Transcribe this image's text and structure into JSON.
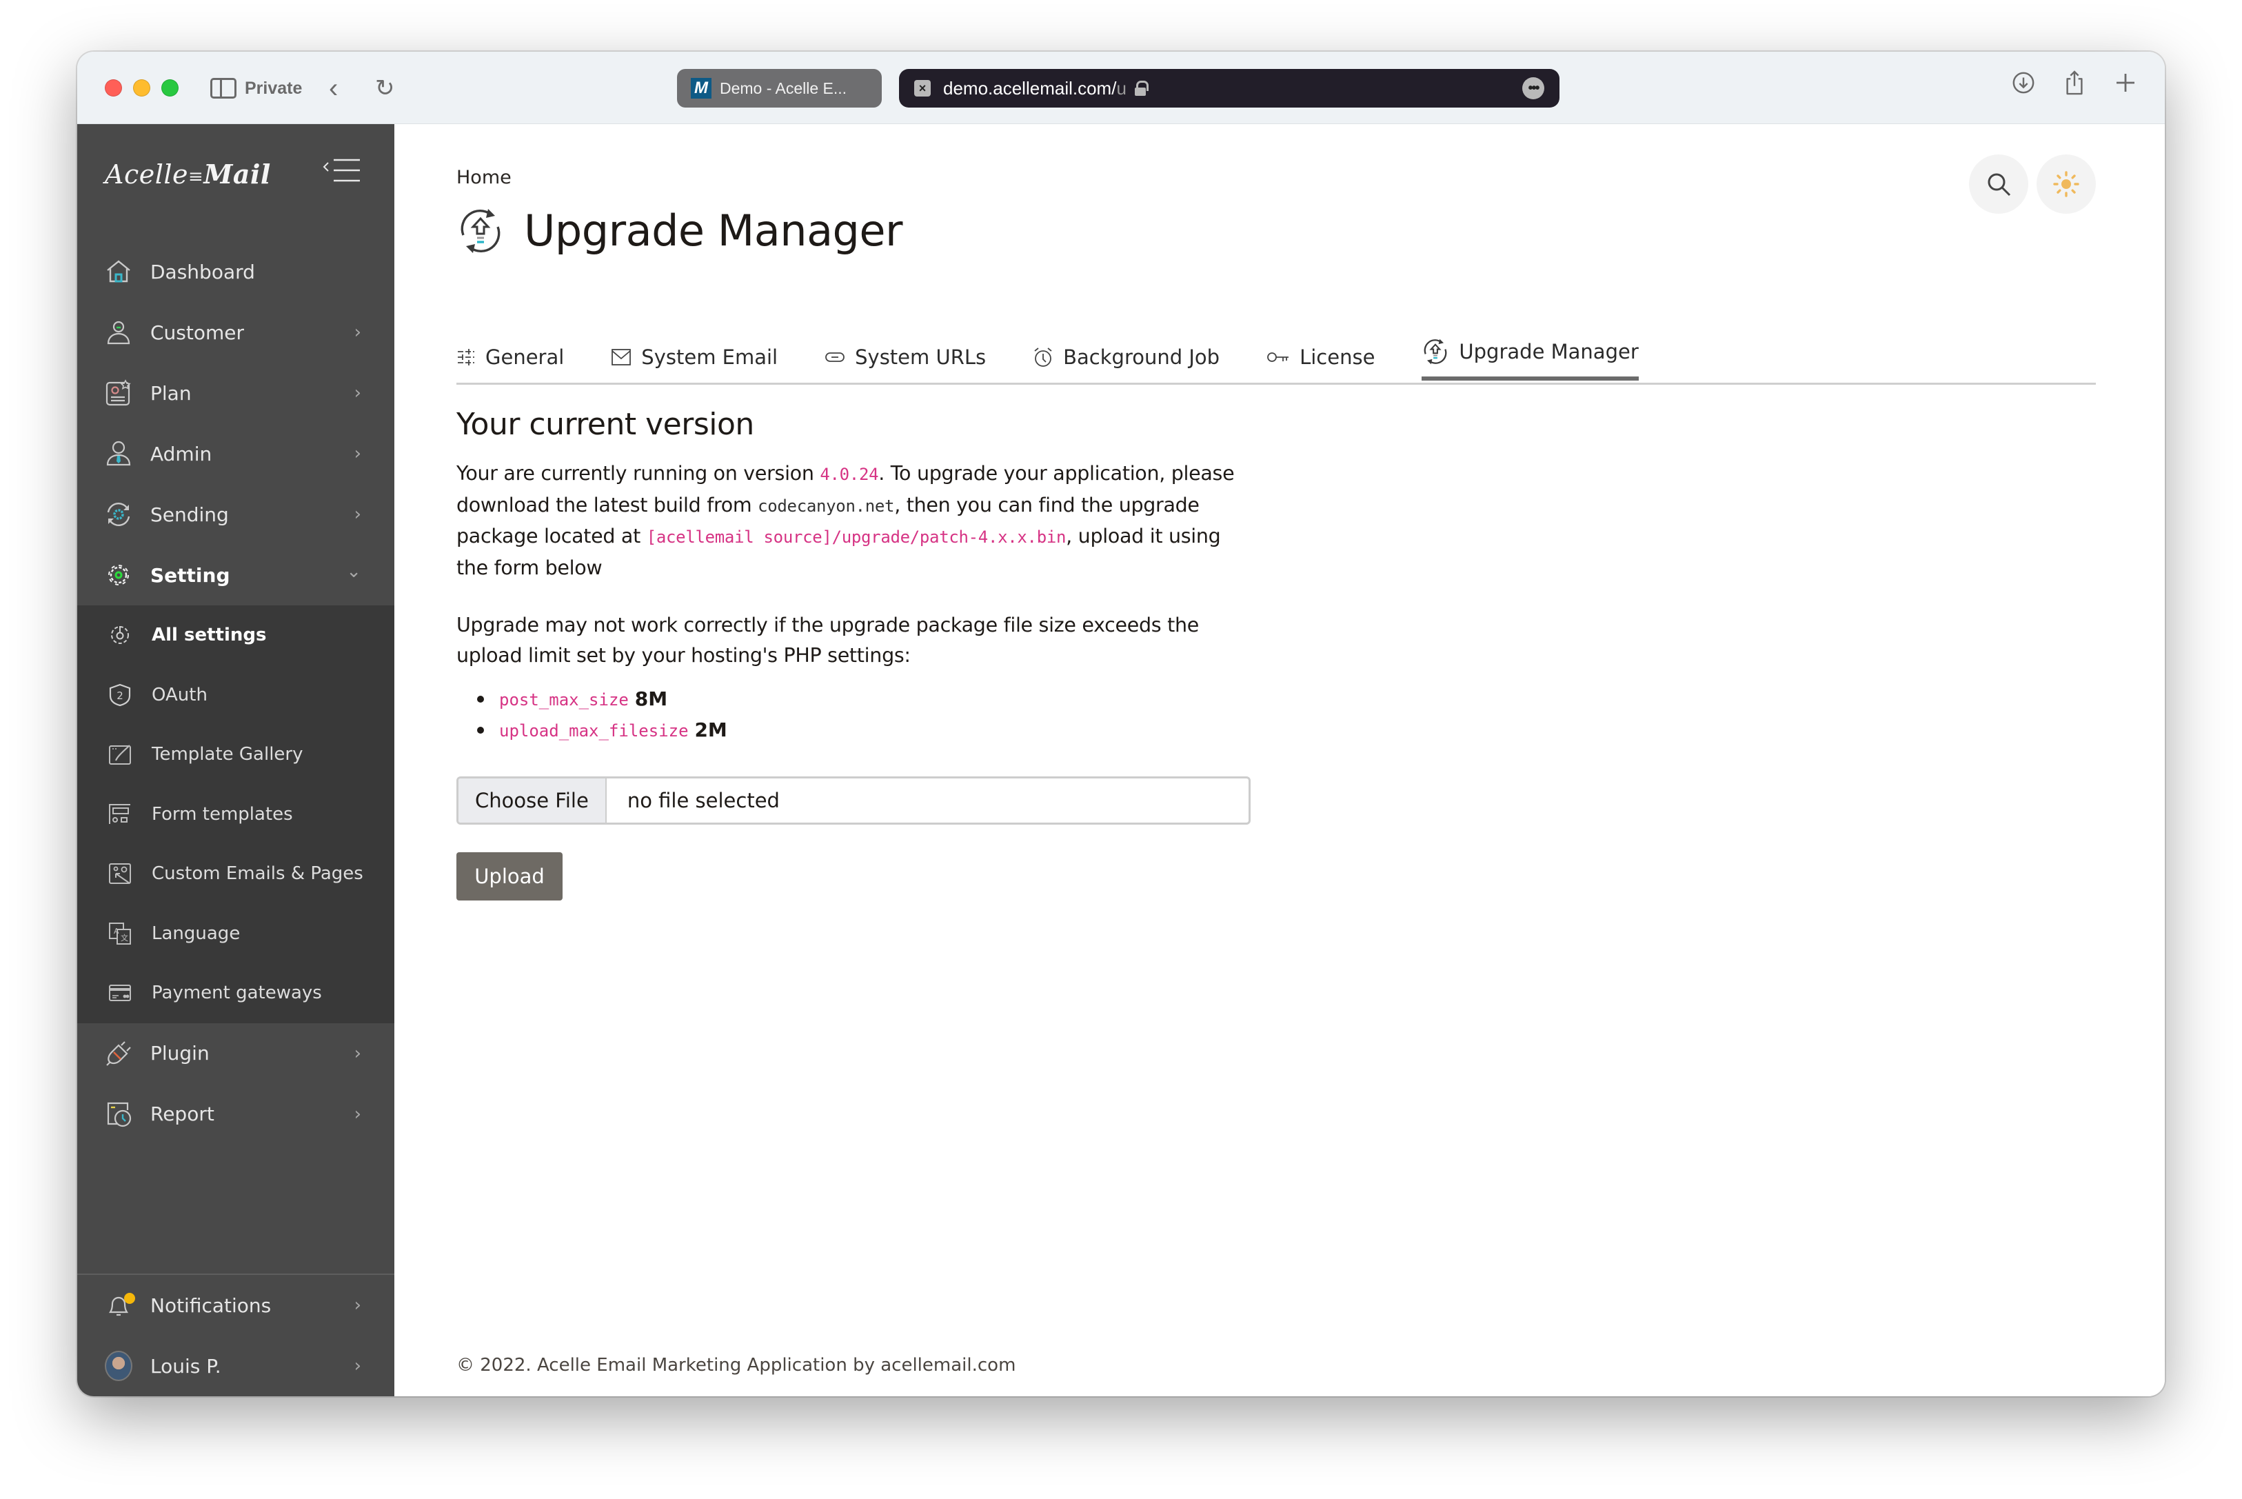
{
  "browser": {
    "mode_label": "Private",
    "tab_inactive": {
      "favicon": "M",
      "title": "Demo - Acelle E..."
    },
    "url": {
      "main": "demo.acellemail.com/",
      "dim": "u"
    },
    "url_close_glyph": "×",
    "more_glyph": "•••",
    "back_glyph": "‹",
    "reload_glyph": "↻"
  },
  "sidebar": {
    "brand": {
      "part1": "Acelle",
      "part2": "Mail"
    },
    "items": [
      {
        "label": "Dashboard",
        "icon": "home-icon",
        "has_children": false
      },
      {
        "label": "Customer",
        "icon": "customer-icon",
        "has_children": true
      },
      {
        "label": "Plan",
        "icon": "plan-icon",
        "has_children": true
      },
      {
        "label": "Admin",
        "icon": "admin-icon",
        "has_children": true
      },
      {
        "label": "Sending",
        "icon": "sending-icon",
        "has_children": true
      },
      {
        "label": "Setting",
        "icon": "setting-gear-icon",
        "has_children": true,
        "expanded": true
      }
    ],
    "setting_children": [
      {
        "label": "All settings",
        "icon": "all-settings-icon",
        "active": true
      },
      {
        "label": "OAuth",
        "icon": "oauth-shield-icon"
      },
      {
        "label": "Template Gallery",
        "icon": "template-gallery-icon"
      },
      {
        "label": "Form templates",
        "icon": "form-templates-icon"
      },
      {
        "label": "Custom Emails & Pages",
        "icon": "custom-pages-icon"
      },
      {
        "label": "Language",
        "icon": "language-icon"
      },
      {
        "label": "Payment gateways",
        "icon": "payment-card-icon"
      }
    ],
    "after_items": [
      {
        "label": "Plugin",
        "icon": "plugin-icon"
      },
      {
        "label": "Report",
        "icon": "report-icon"
      }
    ],
    "bottom": {
      "notifications_label": "Notifications",
      "user_name": "Louis P."
    },
    "chevron_right": "›",
    "chevron_down": "⌄"
  },
  "main": {
    "breadcrumb": "Home",
    "title": "Upgrade Manager",
    "tabs": [
      {
        "label": "General",
        "icon": "sliders-icon"
      },
      {
        "label": "System Email",
        "icon": "envelope-icon"
      },
      {
        "label": "System URLs",
        "icon": "link-icon"
      },
      {
        "label": "Background Job",
        "icon": "alarm-clock-icon"
      },
      {
        "label": "License",
        "icon": "key-icon"
      },
      {
        "label": "Upgrade Manager",
        "icon": "upgrade-icon",
        "active": true
      }
    ],
    "section_title": "Your current version",
    "para1": {
      "t1": "Your are currently running on version ",
      "version": "4.0.24",
      "t2": ". To upgrade your application, please download the latest build from ",
      "site": "codecanyon.net",
      "t3": ", then you can find the upgrade package located at ",
      "path": "[acellemail source]/upgrade/patch-4.x.x.bin",
      "t4": ", upload it using the form below"
    },
    "para2": "Upgrade may not work correctly if the upgrade package file size exceeds the upload limit set by your hosting's PHP settings:",
    "limits": [
      {
        "key": "post_max_size",
        "value": "8M"
      },
      {
        "key": "upload_max_filesize",
        "value": "2M"
      }
    ],
    "file_input": {
      "button_label": "Choose File",
      "status": "no file selected"
    },
    "upload_label": "Upload",
    "footer": "© 2022. Acelle Email Marketing Application by acellemail.com"
  },
  "colors": {
    "sidebar_bg": "#494949",
    "submenu_bg": "#393939",
    "code_accent": "#d63384",
    "upload_button": "#6e6a64",
    "notification_dot": "#f5b70a",
    "theme_sun": "#f0b95c"
  }
}
